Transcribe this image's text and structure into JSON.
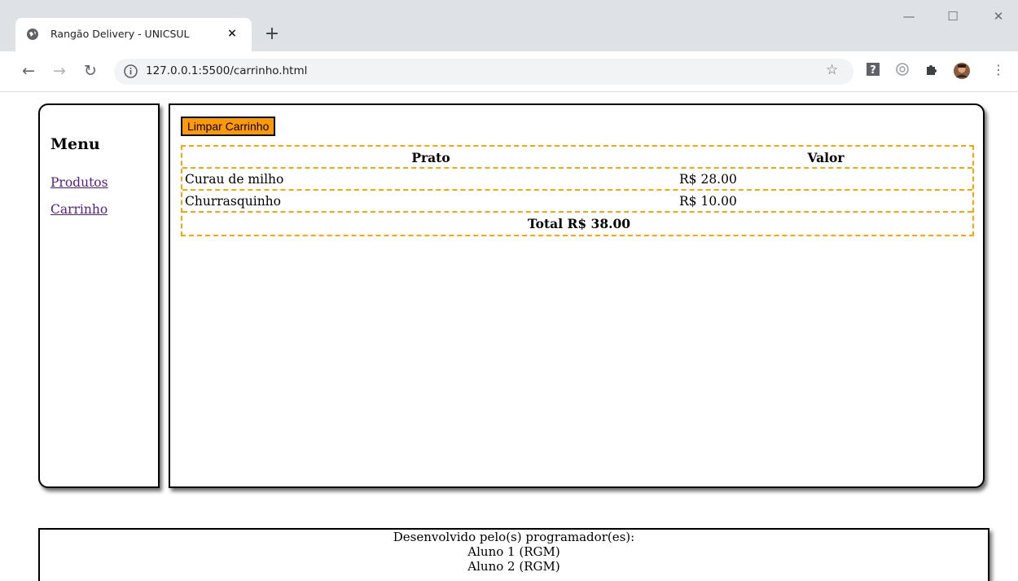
{
  "browser": {
    "tab_title": "Rangão Delivery - UNICSUL",
    "tab_close": "×",
    "new_tab": "+",
    "url": "127.0.0.1:5500/carrinho.html",
    "window_controls": {
      "minimize": "—",
      "maximize": "☐",
      "close": "✕"
    }
  },
  "menu": {
    "title": "Menu",
    "links": [
      "Produtos",
      "Carrinho"
    ]
  },
  "cart": {
    "clear_button": "Limpar Carrinho",
    "headers": [
      "Prato",
      "Valor"
    ],
    "rows": [
      {
        "name": "Curau de milho",
        "value": "R$ 28.00"
      },
      {
        "name": "Churrasquinho",
        "value": "R$ 10.00"
      }
    ],
    "total": "Total R$ 38.00"
  },
  "footer": {
    "lines": [
      "Desenvolvido pelo(s) programador(es):",
      "Aluno 1 (RGM)",
      "Aluno 2 (RGM)"
    ]
  },
  "colors": {
    "accent": "#ff9900",
    "table_border": "#ffa500",
    "visited_link": "#551a8b"
  }
}
